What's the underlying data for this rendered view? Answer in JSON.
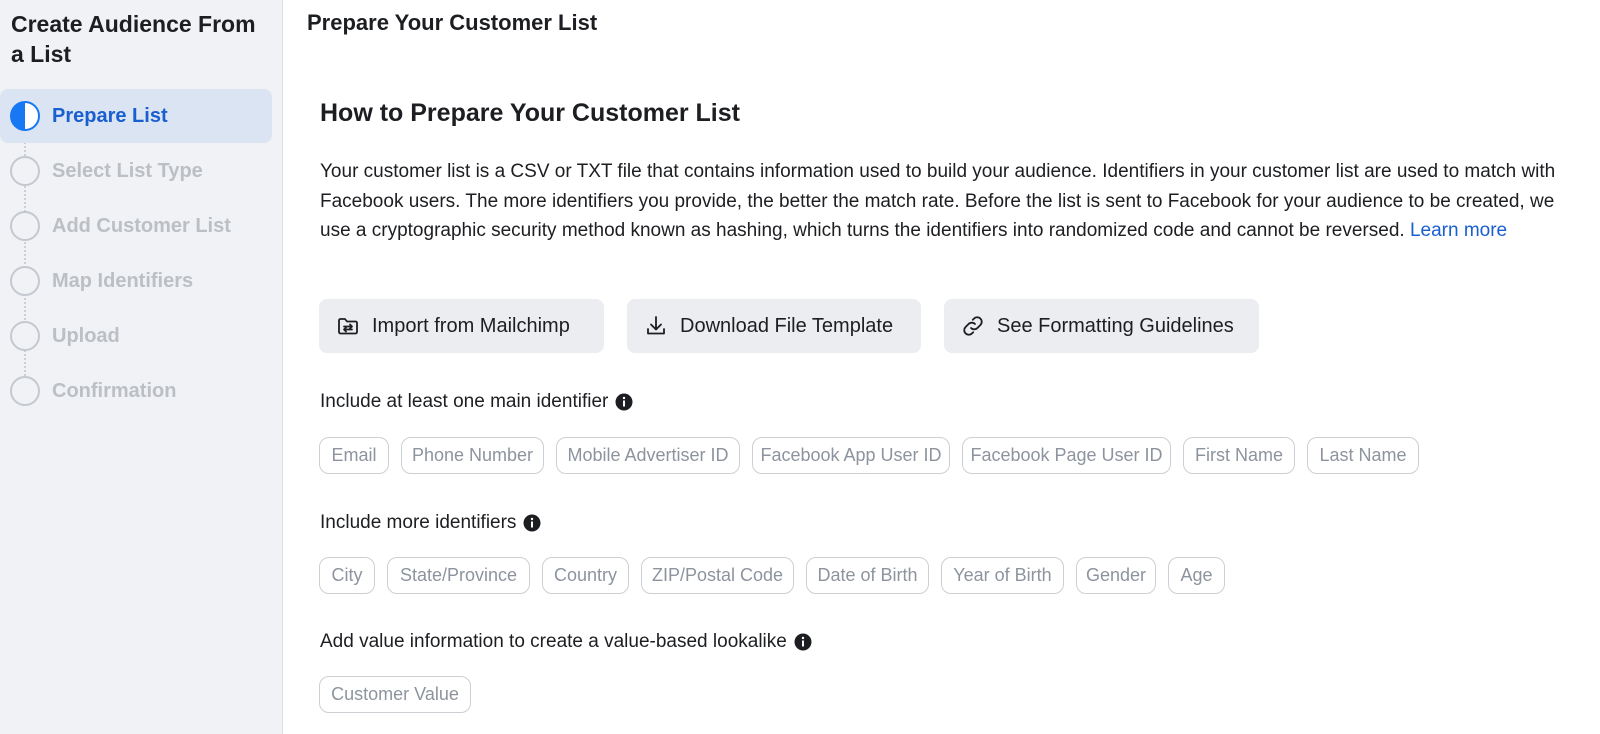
{
  "sidebar": {
    "title": "Create Audience From a List",
    "steps": [
      {
        "label": "Prepare List",
        "state": "active"
      },
      {
        "label": "Select List Type",
        "state": "pending"
      },
      {
        "label": "Add Customer List",
        "state": "pending"
      },
      {
        "label": "Map Identifiers",
        "state": "pending"
      },
      {
        "label": "Upload",
        "state": "pending"
      },
      {
        "label": "Confirmation",
        "state": "pending"
      }
    ]
  },
  "main": {
    "page_title": "Prepare Your Customer List",
    "section_heading": "How to Prepare Your Customer List",
    "description": "Your customer list is a CSV or TXT file that contains information used to build your audience. Identifiers in your customer list are used to match with Facebook users. The more identifiers you provide, the better the match rate. Before the list is sent to Facebook for your audience to be created, we use a cryptographic security method known as hashing, which turns the identifiers into randomized code and cannot be reversed.",
    "learn_more": "Learn more",
    "actions": [
      {
        "label": "Import from Mailchimp",
        "icon": "folder-import-icon"
      },
      {
        "label": "Download File Template",
        "icon": "download-icon"
      },
      {
        "label": "See Formatting Guidelines",
        "icon": "link-icon"
      }
    ],
    "main_identifiers": {
      "label": "Include at least one main identifier",
      "chips": [
        "Email",
        "Phone Number",
        "Mobile Advertiser ID",
        "Facebook App User ID",
        "Facebook Page User ID",
        "First Name",
        "Last Name"
      ]
    },
    "more_identifiers": {
      "label": "Include more identifiers",
      "chips": [
        "City",
        "State/Province",
        "Country",
        "ZIP/Postal Code",
        "Date of Birth",
        "Year of Birth",
        "Gender",
        "Age"
      ]
    },
    "value_info": {
      "label": "Add value information to create a value-based lookalike",
      "chips": [
        "Customer Value"
      ]
    }
  },
  "colors": {
    "accent": "#1877f2",
    "link": "#1a5fd0",
    "sidebar_bg": "#f0f2f5",
    "active_step_bg": "#dbe4f3",
    "chip_text": "#8d949e"
  }
}
